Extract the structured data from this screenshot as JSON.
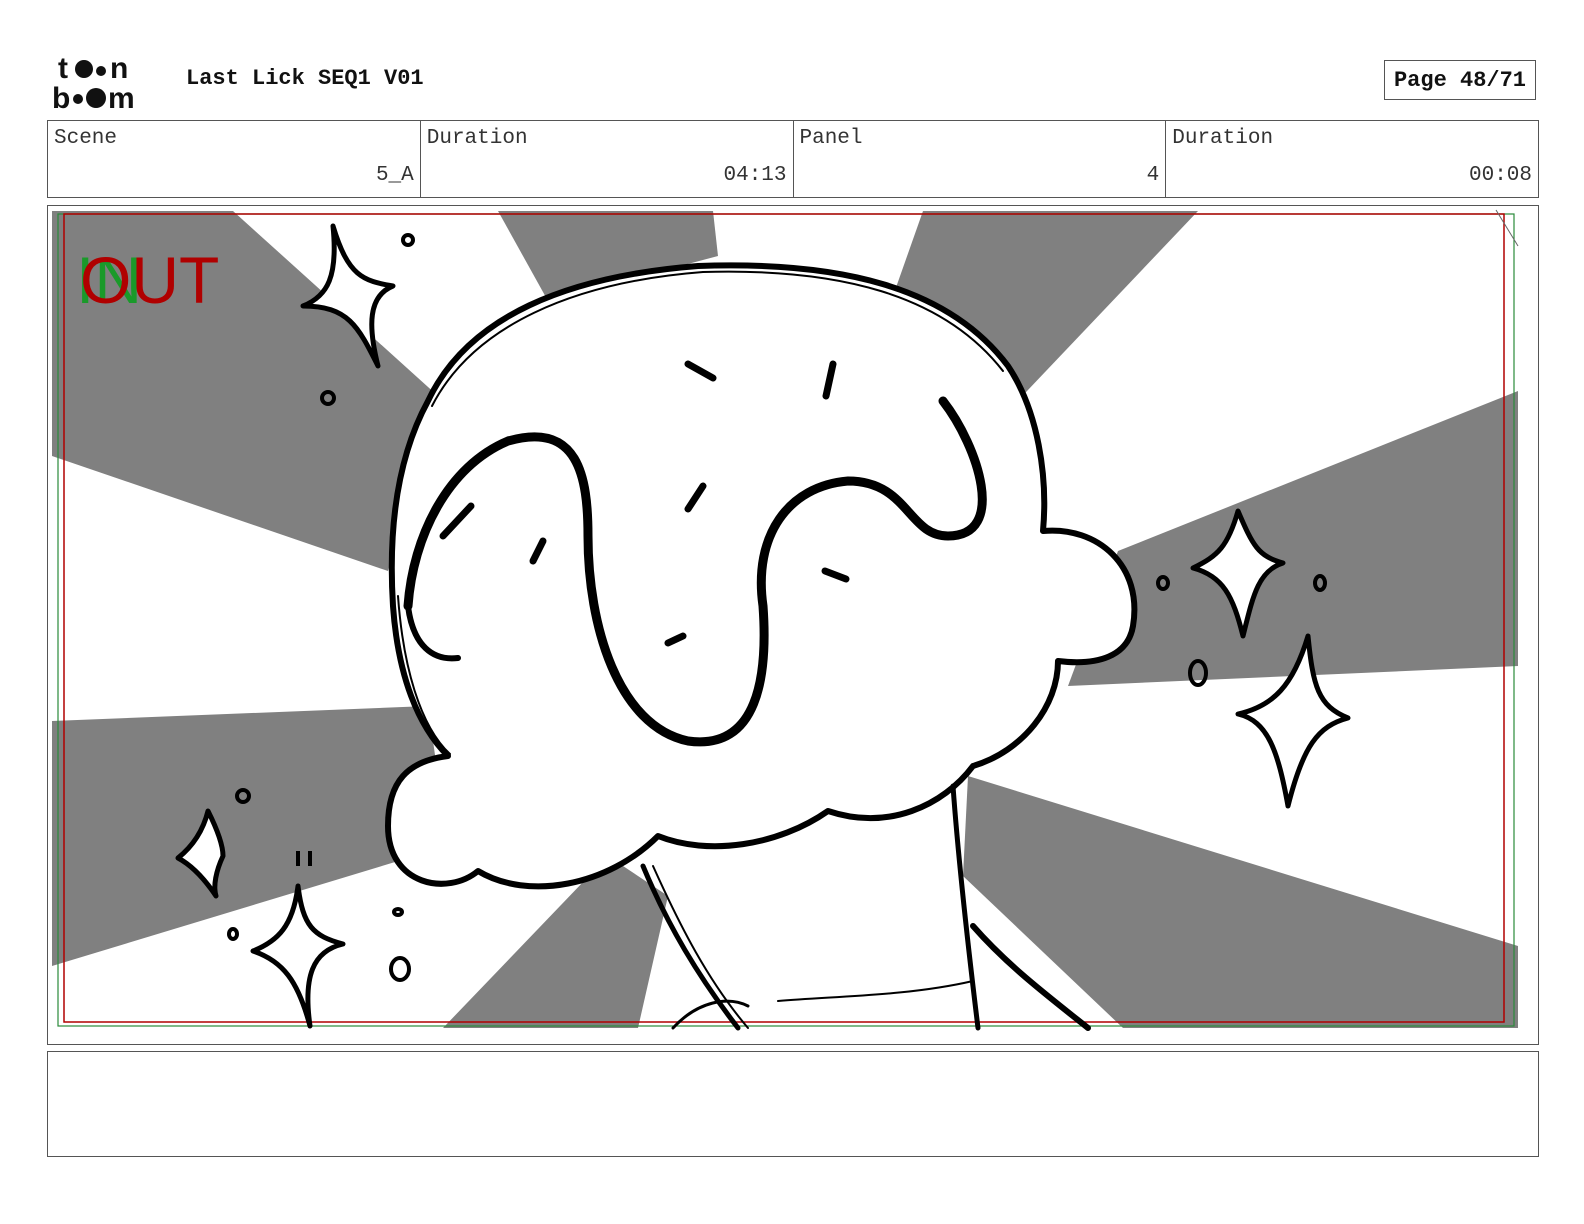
{
  "header": {
    "brand": "toon boom",
    "title": "Last Lick SEQ1 V01",
    "page": "Page 48/71"
  },
  "info": {
    "scene_label": "Scene",
    "scene_value": "5_A",
    "scene_duration_label": "Duration",
    "scene_duration_value": "04:13",
    "panel_label": "Panel",
    "panel_value": "4",
    "panel_duration_label": "Duration",
    "panel_duration_value": "00:08"
  },
  "panel": {
    "in_label": "IN",
    "out_label": "OUT",
    "in_color": "#1a9a2a",
    "out_color": "#b00000",
    "ray_color": "#808080"
  },
  "notes": {
    "text": ""
  }
}
